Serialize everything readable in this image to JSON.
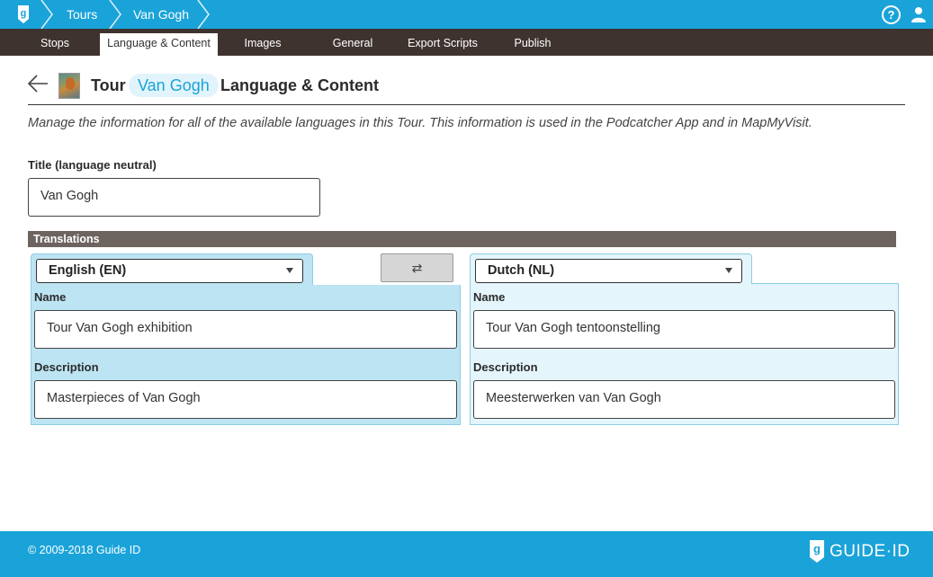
{
  "breadcrumb": {
    "items": [
      {
        "label": "Tours"
      },
      {
        "label": "Van Gogh"
      }
    ]
  },
  "top_icons": {
    "help": "?",
    "help_icon": "help-circle-icon",
    "user_icon": "user-icon",
    "logo_icon": "guide-id-logo-icon"
  },
  "tabs": [
    {
      "label": "Stops"
    },
    {
      "label": "Language & Content",
      "active": true
    },
    {
      "label": "Images"
    },
    {
      "label": "General"
    },
    {
      "label": "Export Scripts"
    },
    {
      "label": "Publish"
    }
  ],
  "header": {
    "prefix": "Tour",
    "name": "Van Gogh",
    "suffix": "Language & Content",
    "back_icon": "arrow-left-icon"
  },
  "intro": "Manage the information for all of the available languages in this Tour. This information is used in the Podcatcher App and in MapMyVisit.",
  "title_field": {
    "label": "Title (language neutral)",
    "value": "Van Gogh"
  },
  "translations": {
    "heading": "Translations",
    "swap_icon": "⇄",
    "left": {
      "language": "English (EN)",
      "name_label": "Name",
      "name_value": "Tour Van Gogh exhibition",
      "description_label": "Description",
      "description_value": "Masterpieces of Van Gogh"
    },
    "right": {
      "language": "Dutch (NL)",
      "name_label": "Name",
      "name_value": "Tour Van Gogh tentoonstelling",
      "description_label": "Description",
      "description_value": "Meesterwerken van Van Gogh"
    }
  },
  "footer": {
    "copyright": "© 2009-2018 Guide ID",
    "brand": "GUIDE·ID"
  },
  "colors": {
    "accent": "#1aa3d9",
    "tabbar": "#3f3330",
    "panel_left": "#bde4f3",
    "panel_right": "#e4f5fb"
  }
}
